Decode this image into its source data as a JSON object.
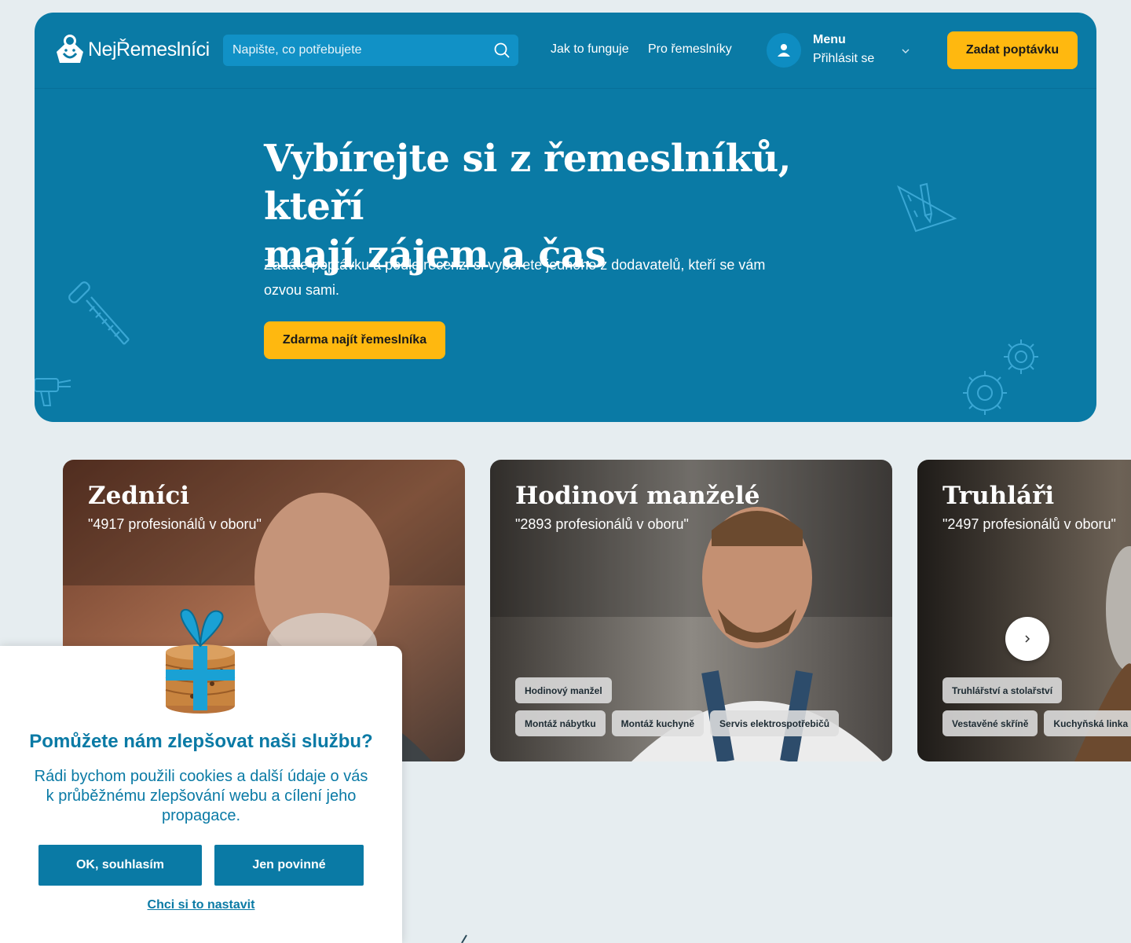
{
  "brand": {
    "name": "NejŘemeslníci"
  },
  "header": {
    "search_placeholder": "Napište, co potřebujete",
    "nav": [
      "Jak to funguje",
      "Pro řemeslníky"
    ],
    "menu_title": "Menu",
    "menu_login": "Přihlásit se",
    "cta": "Zadat poptávku"
  },
  "hero": {
    "title_line1": "Vybírejte si z řemeslníků, kteří",
    "title_line2": "mají zájem a čas",
    "subtitle": "Zadáte poptávku a podle recenzí si vyberete jednoho z dodavatelů, kteří se vám ozvou sami.",
    "cta": "Zdarma najít řemeslníka"
  },
  "categories": [
    {
      "title": "Zedníci",
      "count": "\"4917 profesionálů v oboru\"",
      "tags": []
    },
    {
      "title": "Hodinoví manželé",
      "count": "\"2893 profesionálů v oboru\"",
      "tags_row1": [
        "Hodinový manžel"
      ],
      "tags_row2": [
        "Montáž nábytku",
        "Montáž kuchyně",
        "Servis elektrospotřebičů"
      ]
    },
    {
      "title": "Truhláři",
      "count": "\"2497 profesionálů v oboru\"",
      "tags_row1": [
        "Truhlářství a stolařství"
      ],
      "tags_row2": [
        "Vestavěné skříně",
        "Kuchyňská linka"
      ]
    }
  ],
  "cookie": {
    "title": "Pomůžete nám zlepšovat naši službu?",
    "text": "Rádi bychom použili cookies a další údaje o vás k průběžnému zlepšování webu a cílení jeho propagace.",
    "accept": "OK, souhlasím",
    "required": "Jen povinné",
    "settings": "Chci si to nastavit"
  },
  "colors": {
    "primary": "#0a7aa5",
    "accent": "#ffb80f",
    "page_bg": "#e6edf0"
  },
  "icons": [
    "logo-mark-icon",
    "search-icon",
    "user-icon",
    "chevron-down-icon",
    "chevron-right-icon",
    "cookie-gift-icon"
  ]
}
